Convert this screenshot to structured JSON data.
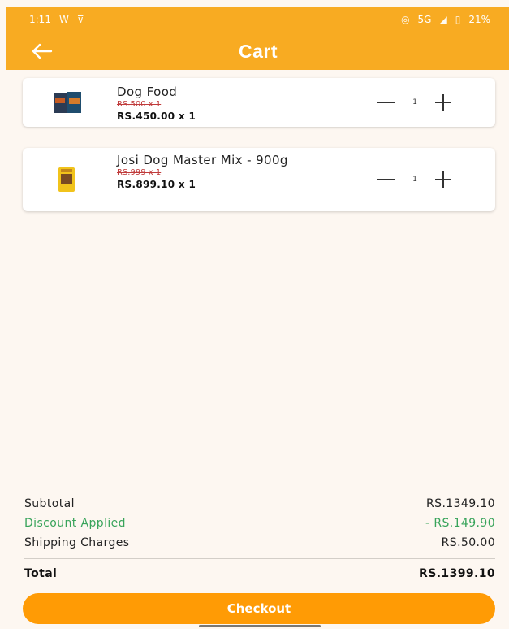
{
  "status_bar": {
    "time": "1:11",
    "network": "5G",
    "battery": "21%"
  },
  "header": {
    "title": "Cart",
    "back_icon": "arrow-left-icon"
  },
  "cart": {
    "items": [
      {
        "name": "Dog Food",
        "original_price": "RS.500 x 1",
        "price": "RS.450.00 x 1",
        "quantity": "1"
      },
      {
        "name": "Josi Dog Master Mix - 900g",
        "original_price": "RS.999 x 1",
        "price": "RS.899.10 x 1",
        "quantity": "1"
      }
    ]
  },
  "summary": {
    "subtotal_label": "Subtotal",
    "subtotal_value": "RS.1349.10",
    "discount_label": "Discount Applied",
    "discount_value": "- RS.149.90",
    "shipping_label": "Shipping Charges",
    "shipping_value": "RS.50.00",
    "total_label": "Total",
    "total_value": "RS.1399.10"
  },
  "checkout_label": "Checkout",
  "colors": {
    "accent": "#f8ab22",
    "checkout": "#ff9b05",
    "discount": "#39a45b",
    "strike": "#c03b3b"
  }
}
